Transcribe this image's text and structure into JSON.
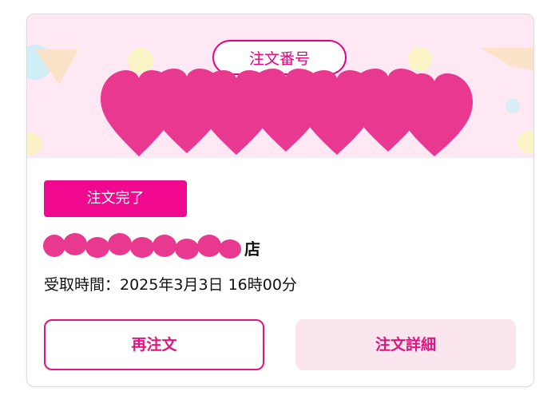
{
  "order_header": {
    "order_number_label": "注文番号"
  },
  "order": {
    "status_label": "注文完了",
    "store_suffix": "店",
    "pickup_time": "受取時間：2025年3月3日 16時00分"
  },
  "actions": {
    "reorder_label": "再注文",
    "details_label": "注文詳細"
  },
  "colors": {
    "brand_pink": "#e6007e",
    "banner_bg": "#fde8f3",
    "redaction_pink": "#e8388f"
  }
}
